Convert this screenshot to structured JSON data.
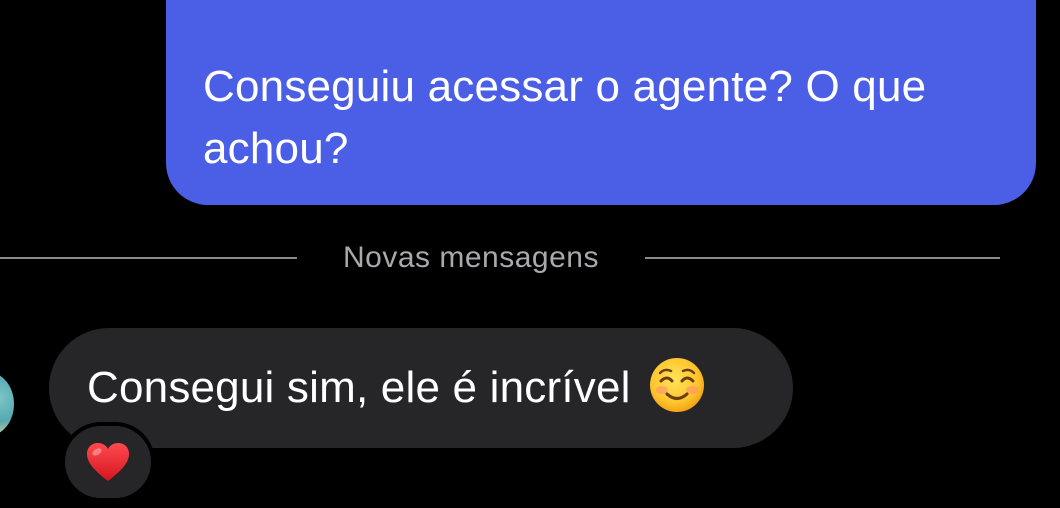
{
  "messages": [
    {
      "direction": "outgoing",
      "text": "Conseguiu acessar o agente? O que achou?",
      "bubble_color": "#4B5FE6"
    },
    {
      "direction": "incoming",
      "text": "Consegui sim, ele é incrível",
      "emoji": "smiling-face-emoji",
      "bubble_color": "#262628",
      "reaction": "red-heart-emoji"
    }
  ],
  "divider": {
    "label": "Novas mensagens"
  },
  "colors": {
    "background": "#000000",
    "divider_line": "#8a8a8e",
    "divider_text": "#a8a8ad",
    "heart": "#E8232B"
  }
}
